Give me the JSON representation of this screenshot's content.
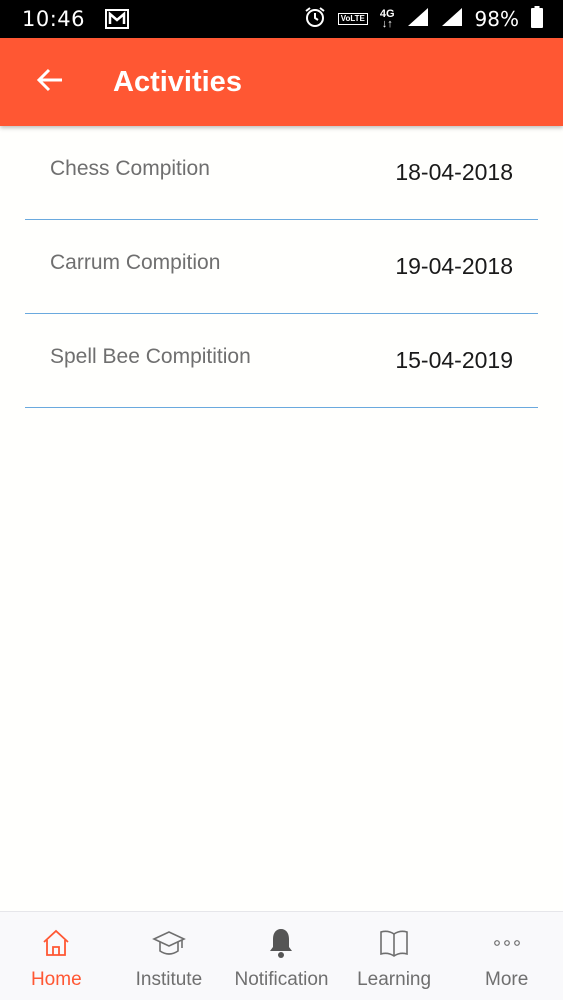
{
  "status_bar": {
    "time": "10:46",
    "volte_label": "VoLTE",
    "network_label": "4G",
    "battery_percent": "98%",
    "icons": [
      "gmail-icon",
      "alarm-icon",
      "volte-icon",
      "4g-data-icon",
      "signal-icon",
      "signal-icon",
      "battery-icon"
    ]
  },
  "app_bar": {
    "title": "Activities",
    "back_icon": "arrow-left-icon",
    "background_color": "#ff5733"
  },
  "activities": [
    {
      "name": "Chess Compition",
      "date": "18-04-2018"
    },
    {
      "name": "Carrum Compition",
      "date": "19-04-2018"
    },
    {
      "name": "Spell Bee Compitition",
      "date": "15-04-2019"
    }
  ],
  "bottom_nav": {
    "active_color": "#ff5733",
    "items": [
      {
        "label": "Home",
        "icon": "home-icon",
        "active": true
      },
      {
        "label": "Institute",
        "icon": "graduation-cap-icon",
        "active": false
      },
      {
        "label": "Notification",
        "icon": "bell-icon",
        "active": false
      },
      {
        "label": "Learning",
        "icon": "book-icon",
        "active": false
      },
      {
        "label": "More",
        "icon": "more-dots-icon",
        "active": false
      }
    ]
  }
}
